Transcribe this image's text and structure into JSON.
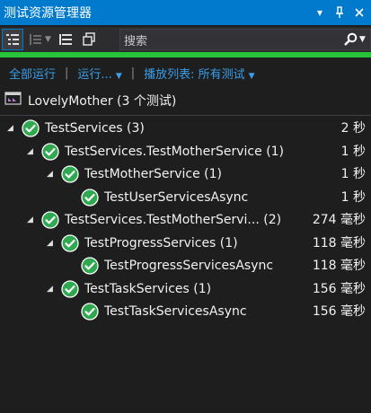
{
  "window": {
    "title": "测试资源管理器",
    "dropdown_icon": "dropdown-icon",
    "pin_icon": "pin-icon",
    "close_icon": "close-icon"
  },
  "toolbar": {
    "search_placeholder": "搜索"
  },
  "status": {
    "color": "#25c43a"
  },
  "commands": {
    "run_all": "全部运行",
    "run": "运行...",
    "playlist": "播放列表: 所有测试"
  },
  "project": {
    "label": "LovelyMother (3 个测试)"
  },
  "tests": [
    {
      "name": "TestServices (3)",
      "time": "2 秒",
      "level": 0,
      "expanded": true,
      "status": "passed"
    },
    {
      "name": "TestServices.TestMotherService (1)",
      "time": "1 秒",
      "level": 1,
      "expanded": true,
      "status": "passed"
    },
    {
      "name": "TestMotherService (1)",
      "time": "1 秒",
      "level": 2,
      "expanded": true,
      "status": "passed"
    },
    {
      "name": "TestUserServicesAsync",
      "time": "1 秒",
      "level": 3,
      "expanded": null,
      "status": "passed"
    },
    {
      "name": "TestServices.TestMotherServi... (2)",
      "time": "274 毫秒",
      "level": 1,
      "expanded": true,
      "status": "passed"
    },
    {
      "name": "TestProgressServices (1)",
      "time": "118 毫秒",
      "level": 2,
      "expanded": true,
      "status": "passed"
    },
    {
      "name": "TestProgressServicesAsync",
      "time": "118 毫秒",
      "level": 3,
      "expanded": null,
      "status": "passed"
    },
    {
      "name": "TestTaskServices (1)",
      "time": "156 毫秒",
      "level": 2,
      "expanded": true,
      "status": "passed"
    },
    {
      "name": "TestTaskServicesAsync",
      "time": "156 毫秒",
      "level": 3,
      "expanded": null,
      "status": "passed"
    }
  ]
}
